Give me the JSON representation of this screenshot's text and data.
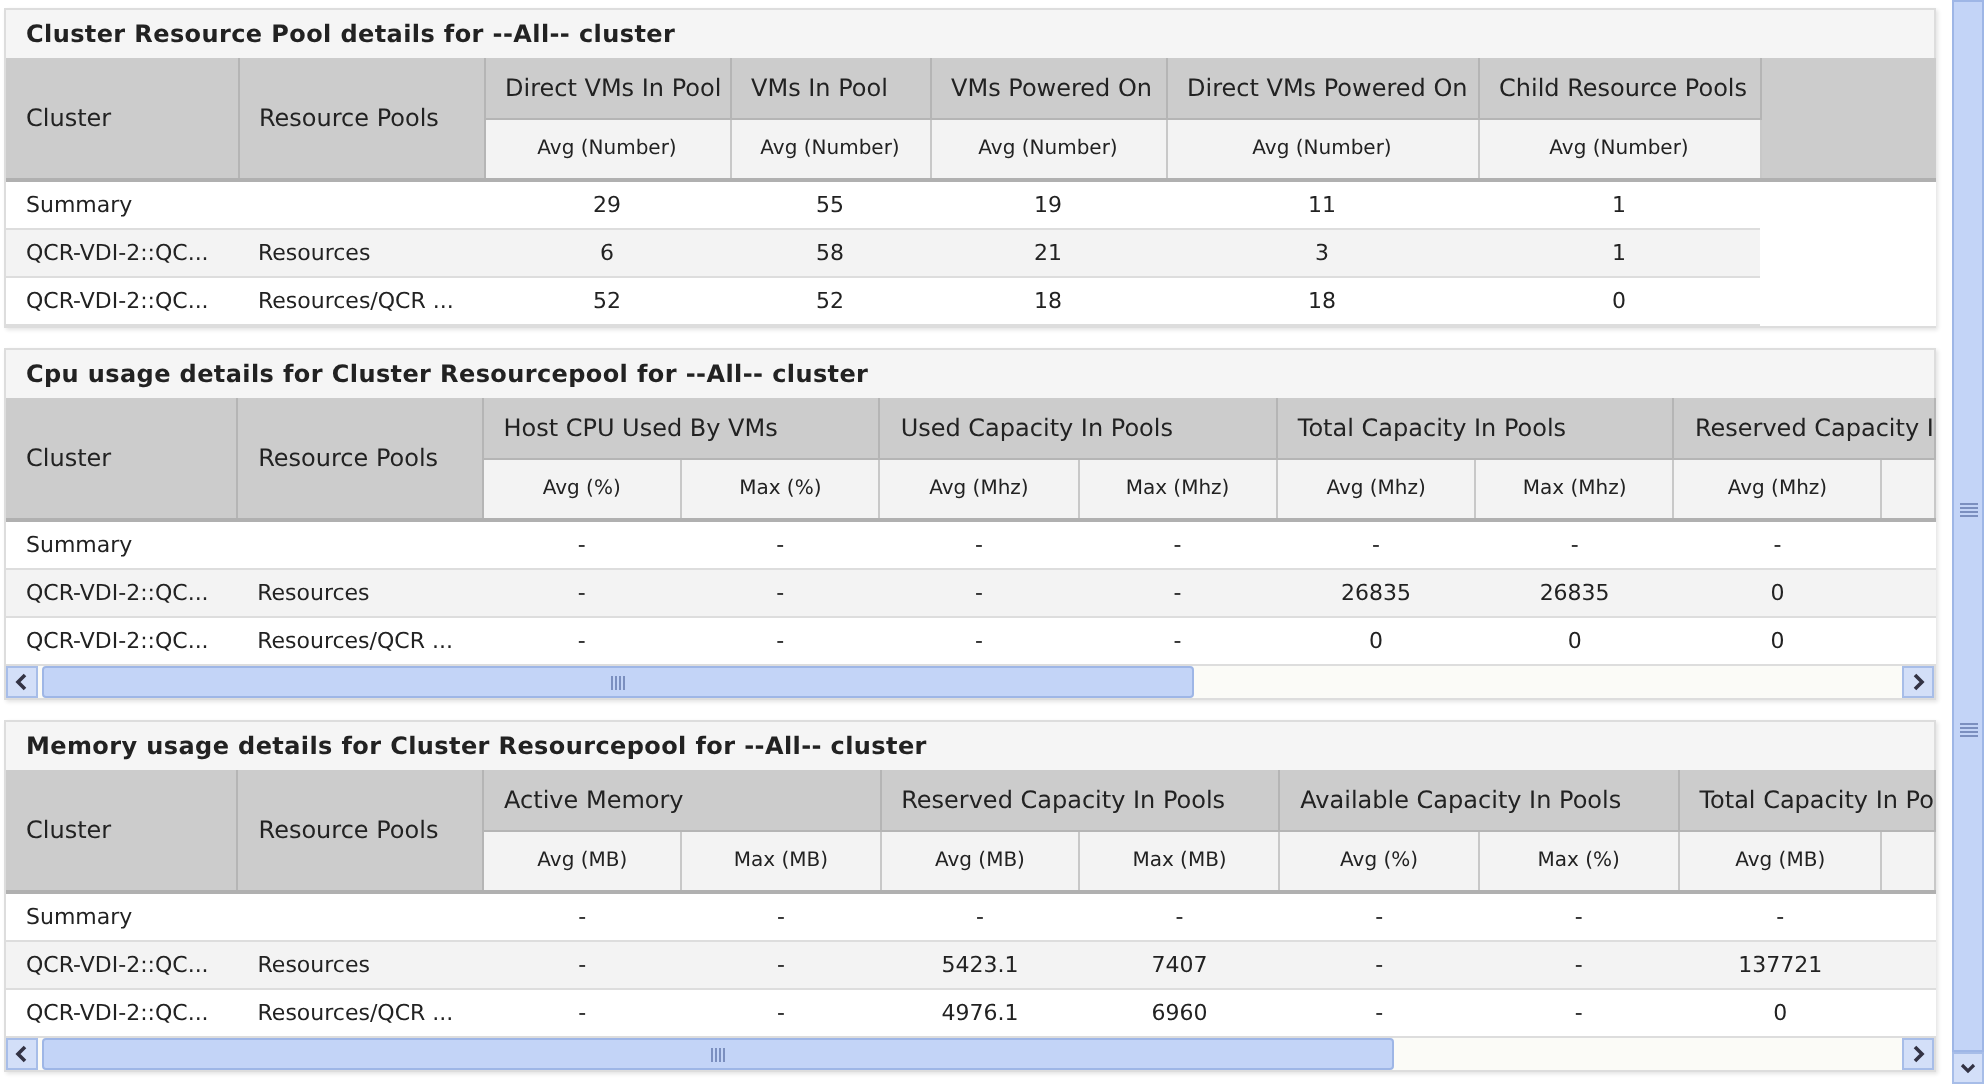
{
  "panels": [
    {
      "title": "Cluster Resource Pool details for --All-- cluster",
      "kind": "plain",
      "fixed_columns": [
        "Cluster",
        "Resource Pools"
      ],
      "groups": [
        {
          "label": "Direct VMs In Pool",
          "subs": [
            "Avg (Number)"
          ]
        },
        {
          "label": "VMs In Pool",
          "subs": [
            "Avg (Number)"
          ]
        },
        {
          "label": "VMs Powered On",
          "subs": [
            "Avg (Number)"
          ]
        },
        {
          "label": "Direct VMs Powered On",
          "subs": [
            "Avg (Number)"
          ]
        },
        {
          "label": "Child Resource Pools",
          "subs": [
            "Avg (Number)"
          ]
        }
      ],
      "rows": [
        {
          "cluster": "Summary",
          "pool": "",
          "values": [
            "29",
            "55",
            "19",
            "11",
            "1"
          ]
        },
        {
          "cluster": "QCR-VDI-2::QC...",
          "pool": "Resources",
          "values": [
            "6",
            "58",
            "21",
            "3",
            "1"
          ]
        },
        {
          "cluster": "QCR-VDI-2::QC...",
          "pool": "Resources/QCR ...",
          "values": [
            "52",
            "52",
            "18",
            "18",
            "0"
          ]
        }
      ]
    },
    {
      "title": "Cpu usage details for Cluster Resourcepool for --All-- cluster",
      "kind": "scroll",
      "fixed_columns": [
        "Cluster",
        "Resource Pools"
      ],
      "groups": [
        {
          "label": "Host CPU Used By VMs",
          "subs": [
            "Avg (%)",
            "Max (%)"
          ]
        },
        {
          "label": "Used Capacity In Pools",
          "subs": [
            "Avg (Mhz)",
            "Max (Mhz)"
          ]
        },
        {
          "label": "Total Capacity In Pools",
          "subs": [
            "Avg (Mhz)",
            "Max (Mhz)"
          ]
        },
        {
          "label": "Reserved Capacity I",
          "subs": [
            "Avg (Mhz)"
          ]
        }
      ],
      "rows": [
        {
          "cluster": "Summary",
          "pool": "",
          "values": [
            "-",
            "-",
            "-",
            "-",
            "-",
            "-",
            "-"
          ]
        },
        {
          "cluster": "QCR-VDI-2::QC...",
          "pool": "Resources",
          "values": [
            "-",
            "-",
            "-",
            "-",
            "26835",
            "26835",
            "0"
          ]
        },
        {
          "cluster": "QCR-VDI-2::QC...",
          "pool": "Resources/QCR ...",
          "values": [
            "-",
            "-",
            "-",
            "-",
            "0",
            "0",
            "0"
          ]
        }
      ]
    },
    {
      "title": "Memory usage details for Cluster Resourcepool for --All-- cluster",
      "kind": "scroll",
      "fixed_columns": [
        "Cluster",
        "Resource Pools"
      ],
      "groups": [
        {
          "label": "Active Memory",
          "subs": [
            "Avg (MB)",
            "Max (MB)"
          ]
        },
        {
          "label": "Reserved Capacity In Pools",
          "subs": [
            "Avg (MB)",
            "Max (MB)"
          ]
        },
        {
          "label": "Available Capacity In Pools",
          "subs": [
            "Avg (%)",
            "Max (%)"
          ]
        },
        {
          "label": "Total Capacity In Po",
          "subs": [
            "Avg (MB)"
          ]
        }
      ],
      "rows": [
        {
          "cluster": "Summary",
          "pool": "",
          "values": [
            "-",
            "-",
            "-",
            "-",
            "-",
            "-",
            "-"
          ]
        },
        {
          "cluster": "QCR-VDI-2::QC...",
          "pool": "Resources",
          "values": [
            "-",
            "-",
            "5423.1",
            "7407",
            "-",
            "-",
            "137721"
          ]
        },
        {
          "cluster": "QCR-VDI-2::QC...",
          "pool": "Resources/QCR ...",
          "values": [
            "-",
            "-",
            "4976.1",
            "6960",
            "-",
            "-",
            "0"
          ]
        }
      ]
    }
  ]
}
